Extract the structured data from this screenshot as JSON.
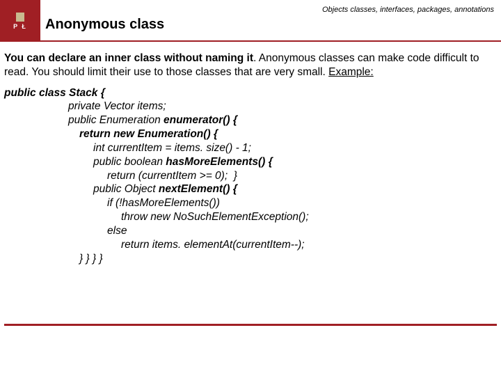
{
  "header": {
    "breadcrumb": "Objects classes, interfaces, packages, annotations",
    "title": "Anonymous class",
    "logo_letters": "P Ł"
  },
  "intro": {
    "bold_lead": "You can declare an inner class without naming it",
    "rest": ". Anonymous classes can make code difficult to read. You should limit their use to those classes that are very small. ",
    "example_label": "Example:"
  },
  "code": {
    "l0": "public class Stack {",
    "l1": "private Vector items;",
    "l2a": "public Enumeration ",
    "l2b": "enumerator() {",
    "l3a": "return new ",
    "l3b": "Enumeration",
    "l3c": "() {",
    "l4": "int currentItem = items. size() - 1;",
    "l5a": "public boolean ",
    "l5b": "hasMoreElements() {",
    "l6": "return (currentItem >= 0);  }",
    "l7a": "public Object ",
    "l7b": "nextElement() {",
    "l8": "if (!hasMoreElements())",
    "l9": "throw new NoSuchElementException();",
    "l10": "else",
    "l11": "return items. elementAt(currentItem--);",
    "l12": "} } } }"
  }
}
